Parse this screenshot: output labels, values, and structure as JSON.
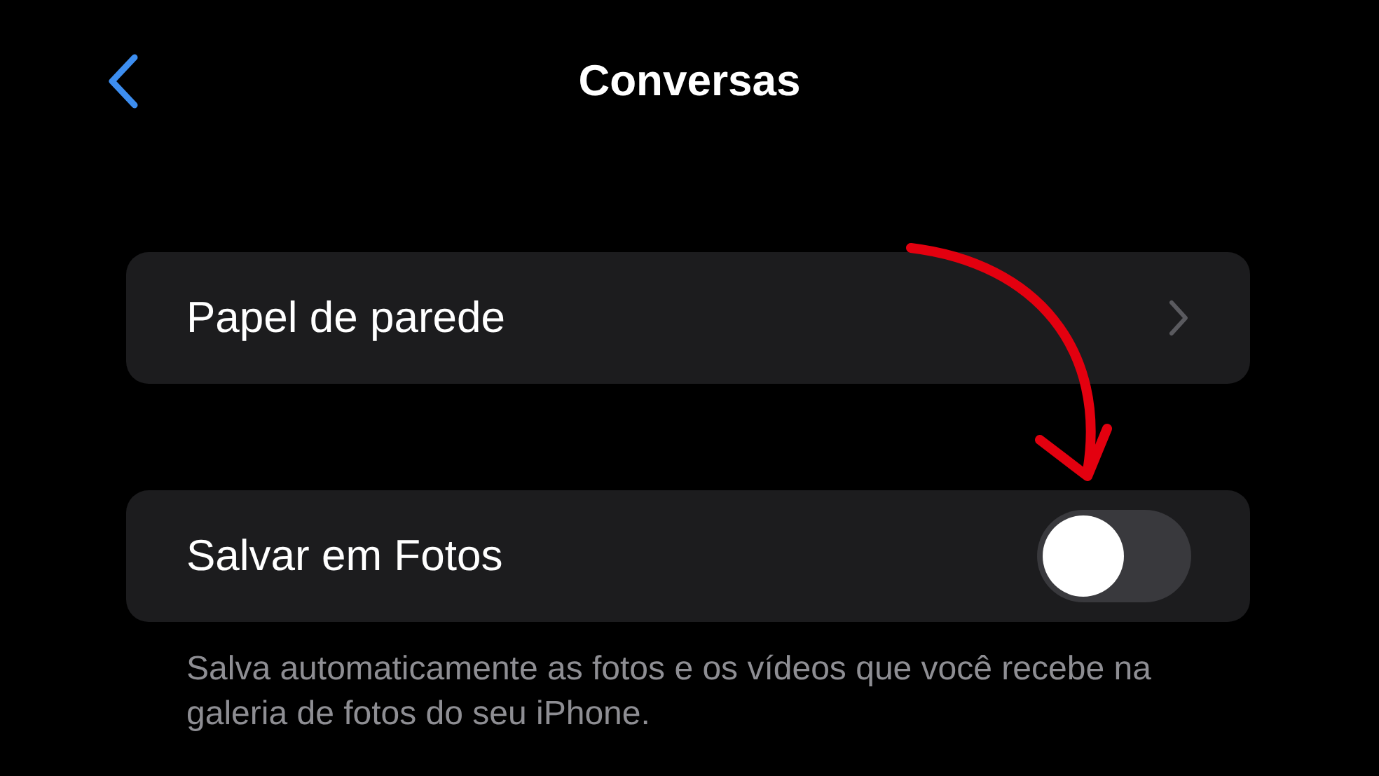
{
  "header": {
    "title": "Conversas"
  },
  "groups": [
    {
      "rows": [
        {
          "kind": "link",
          "label": "Papel de parede"
        }
      ]
    },
    {
      "rows": [
        {
          "kind": "toggle",
          "label": "Salvar em Fotos",
          "on": false
        }
      ],
      "footer": "Salva automaticamente as fotos e os vídeos que você recebe na galeria de fotos do seu iPhone."
    }
  ]
}
